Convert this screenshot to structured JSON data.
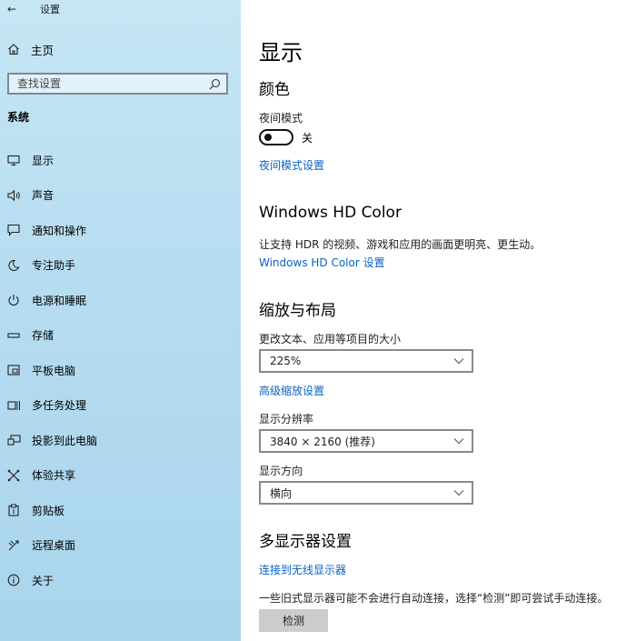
{
  "window": {
    "title": "设置"
  },
  "sidebar": {
    "home_label": "主页",
    "search_placeholder": "查找设置",
    "section": "系统",
    "items": [
      {
        "label": "显示",
        "icon": "monitor-icon"
      },
      {
        "label": "声音",
        "icon": "speaker-icon"
      },
      {
        "label": "通知和操作",
        "icon": "notification-icon"
      },
      {
        "label": "专注助手",
        "icon": "moon-icon"
      },
      {
        "label": "电源和睡眠",
        "icon": "power-icon"
      },
      {
        "label": "存储",
        "icon": "storage-icon"
      },
      {
        "label": "平板电脑",
        "icon": "tablet-icon"
      },
      {
        "label": "多任务处理",
        "icon": "multitask-icon"
      },
      {
        "label": "投影到此电脑",
        "icon": "project-icon"
      },
      {
        "label": "体验共享",
        "icon": "share-icon"
      },
      {
        "label": "剪贴板",
        "icon": "clipboard-icon"
      },
      {
        "label": "远程桌面",
        "icon": "remote-icon"
      },
      {
        "label": "关于",
        "icon": "info-icon"
      }
    ]
  },
  "main": {
    "title": "显示",
    "color": {
      "heading": "颜色",
      "night_mode_label": "夜间模式",
      "night_mode_state": "关",
      "night_mode_settings_link": "夜间模式设置"
    },
    "hdr": {
      "heading": "Windows HD Color",
      "description": "让支持 HDR 的视频、游戏和应用的画面更明亮、更生动。",
      "settings_link": "Windows HD Color 设置"
    },
    "scale": {
      "heading": "缩放与布局",
      "size_label": "更改文本、应用等项目的大小",
      "size_value": "225%",
      "advanced_link": "高级缩放设置",
      "resolution_label": "显示分辨率",
      "resolution_value": "3840 × 2160 (推荐)",
      "orientation_label": "显示方向",
      "orientation_value": "横向"
    },
    "multi": {
      "heading": "多显示器设置",
      "wireless_link": "连接到无线显示器",
      "note": "一些旧式显示器可能不会进行自动连接，选择“检测”即可尝试手动连接。",
      "detect_button": "检测"
    }
  },
  "colors": {
    "accent_link": "#0b62c4",
    "sidebar_bg": "#b6dcf0",
    "button_bg": "#cccccc"
  }
}
